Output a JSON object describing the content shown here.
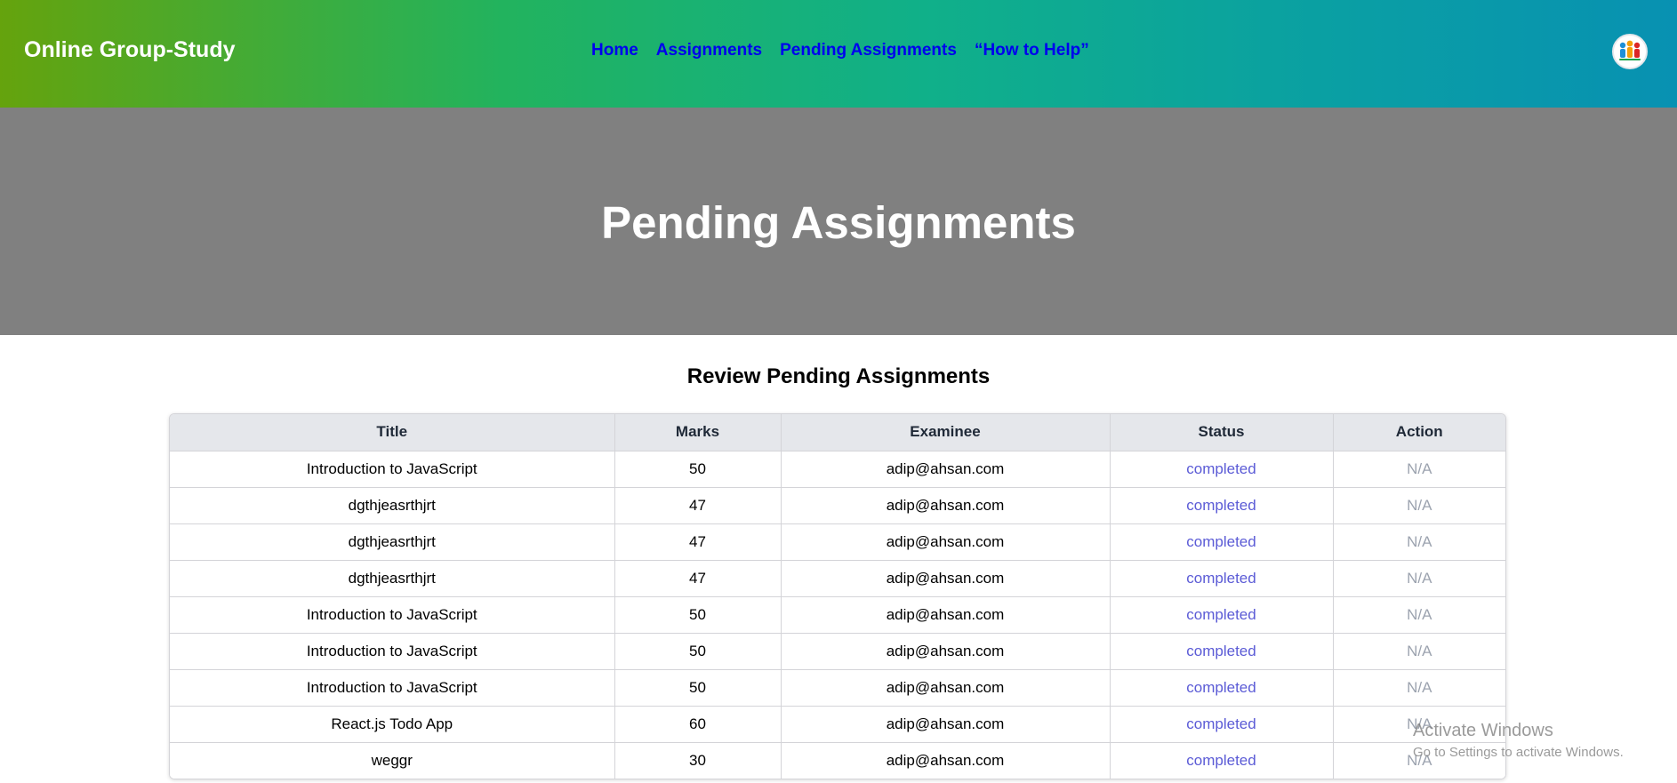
{
  "navbar": {
    "brand": "Online Group-Study",
    "links": [
      {
        "label": "Home"
      },
      {
        "label": "Assignments"
      },
      {
        "label": "Pending Assignments"
      },
      {
        "label": "“How to Help”"
      }
    ]
  },
  "hero": {
    "title": "Pending Assignments"
  },
  "main": {
    "section_title": "Review Pending Assignments",
    "table": {
      "headers": [
        "Title",
        "Marks",
        "Examinee",
        "Status",
        "Action"
      ],
      "rows": [
        {
          "title": "Introduction to JavaScript",
          "marks": "50",
          "examinee": "adip@ahsan.com",
          "status": "completed",
          "action": "N/A"
        },
        {
          "title": "dgthjeasrthjrt",
          "marks": "47",
          "examinee": "adip@ahsan.com",
          "status": "completed",
          "action": "N/A"
        },
        {
          "title": "dgthjeasrthjrt",
          "marks": "47",
          "examinee": "adip@ahsan.com",
          "status": "completed",
          "action": "N/A"
        },
        {
          "title": "dgthjeasrthjrt",
          "marks": "47",
          "examinee": "adip@ahsan.com",
          "status": "completed",
          "action": "N/A"
        },
        {
          "title": "Introduction to JavaScript",
          "marks": "50",
          "examinee": "adip@ahsan.com",
          "status": "completed",
          "action": "N/A"
        },
        {
          "title": "Introduction to JavaScript",
          "marks": "50",
          "examinee": "adip@ahsan.com",
          "status": "completed",
          "action": "N/A"
        },
        {
          "title": "Introduction to JavaScript",
          "marks": "50",
          "examinee": "adip@ahsan.com",
          "status": "completed",
          "action": "N/A"
        },
        {
          "title": "React.js Todo App",
          "marks": "60",
          "examinee": "adip@ahsan.com",
          "status": "completed",
          "action": "N/A"
        },
        {
          "title": "weggr",
          "marks": "30",
          "examinee": "adip@ahsan.com",
          "status": "completed",
          "action": "N/A"
        }
      ]
    }
  },
  "watermark": {
    "title": "Activate Windows",
    "subtitle": "Go to Settings to activate Windows."
  },
  "colors": {
    "nav_gradient_start": "#65a30d",
    "nav_gradient_end": "#0891b2",
    "nav_link": "#0000ee",
    "hero_bg": "#808080",
    "status": "#5b5bd6",
    "action": "#9ca3af"
  },
  "icons": {
    "avatar": "user-group-avatar-icon"
  }
}
